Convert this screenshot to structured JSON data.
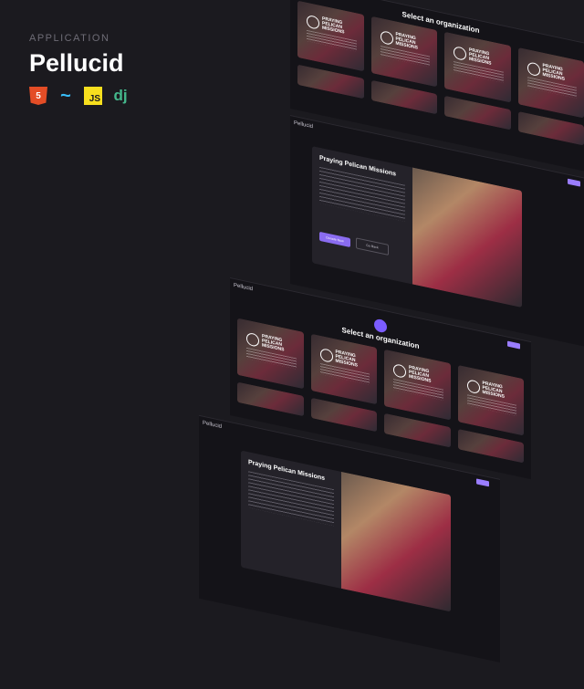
{
  "header": {
    "eyebrow": "APPLICATION",
    "title": "Pellucid",
    "stack": [
      {
        "icon": "html5-icon",
        "label": "5"
      },
      {
        "icon": "tailwind-icon",
        "label": "~"
      },
      {
        "icon": "javascript-icon",
        "label": "JS"
      },
      {
        "icon": "django-icon",
        "label": "dj"
      }
    ]
  },
  "app": {
    "brand": "Pellucid",
    "select_title": "Select an organization",
    "org_name": "Praying Pelican Missions",
    "org_logo_lines": [
      "PRAYING",
      "PELICAN",
      "MISSIONS"
    ],
    "primary_action": "Donate Now",
    "secondary_action": "Go Back"
  },
  "colors": {
    "accent": "#8a6cf0",
    "background": "#1b1a1f"
  }
}
